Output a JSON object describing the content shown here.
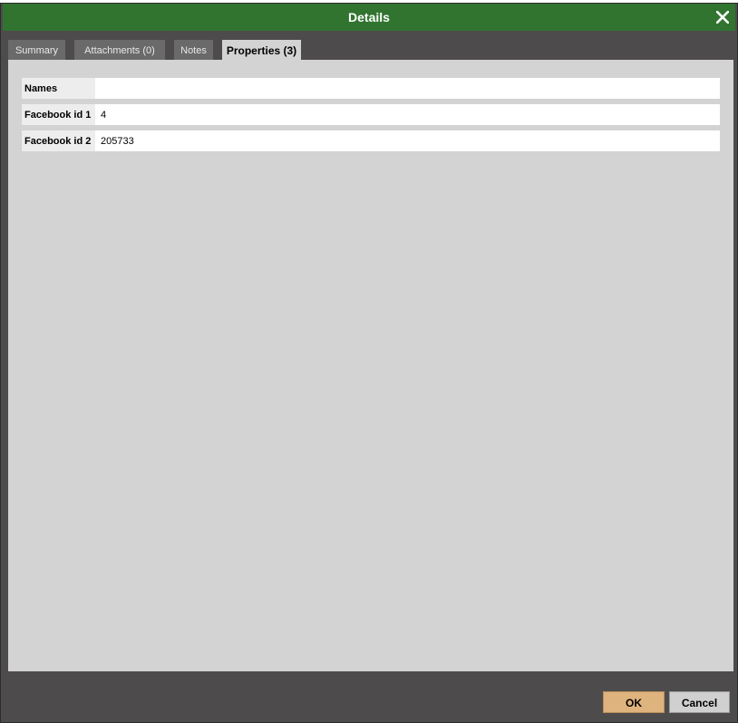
{
  "dialog": {
    "title": "Details",
    "close_icon": "close-icon"
  },
  "tabs": [
    {
      "label": "Summary",
      "active": false
    },
    {
      "label": "Attachments (0)",
      "active": false
    },
    {
      "label": "Notes",
      "active": false
    },
    {
      "label": "Properties (3)",
      "active": true
    }
  ],
  "properties": [
    {
      "name": "Names",
      "value": ""
    },
    {
      "name": "Facebook id 1",
      "value": "4"
    },
    {
      "name": "Facebook id 2",
      "value": "205733"
    }
  ],
  "buttons": {
    "ok_label": "OK",
    "cancel_label": "Cancel"
  },
  "colors": {
    "titlebar": "#317430",
    "frame": "#4d4b4c",
    "panel": "#d3d3d3",
    "ok_button": "#dfb37e"
  }
}
